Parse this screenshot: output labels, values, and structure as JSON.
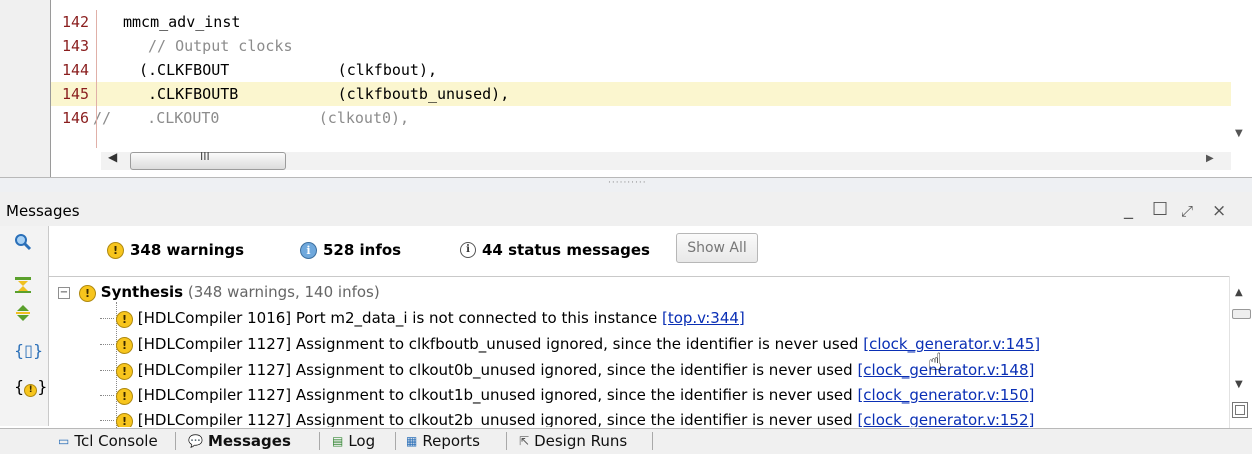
{
  "editor": {
    "lines": [
      {
        "num": "142",
        "text": "mmcm_adv_inst",
        "indent": 1
      },
      {
        "num": "143",
        "text": "// Output clocks",
        "indent": 3
      },
      {
        "num": "144",
        "text": "(.CLKFBOUT            (clkfbout),",
        "indent": 2
      },
      {
        "num": "145",
        "text": ".CLKFBOUTB           (clkfboutb_unused),",
        "indent": 3
      },
      {
        "num": "146",
        "text": "//    .CLKOUT0           (clkout0),",
        "indent": 0
      }
    ],
    "highlighted_line": "145",
    "hscroll_grip": "III"
  },
  "messages_panel": {
    "title": "Messages",
    "window_controls": {
      "minimize": "_",
      "maximize": "☐",
      "float": "⤢",
      "close": "×"
    },
    "filters": {
      "warnings": "348 warnings",
      "infos": "528 infos",
      "status": "44 status messages",
      "show_all": "Show All"
    },
    "toolbar_icons": [
      "search-icon",
      "collapse-all-icon",
      "expand-all-icon",
      "group-icon",
      "warning-filter-icon"
    ],
    "tree": {
      "group": {
        "label": "Synthesis",
        "summary": "(348 warnings, 140 infos)",
        "expander": "−"
      },
      "messages": [
        {
          "text": "[HDLCompiler 1016] Port m2_data_i is not connected to this instance ",
          "link": "[top.v:344]"
        },
        {
          "text": "[HDLCompiler 1127] Assignment to clkfboutb_unused ignored, since the identifier is never used ",
          "link": "[clock_generator.v:145]"
        },
        {
          "text": "[HDLCompiler 1127] Assignment to clkout0b_unused ignored, since the identifier is never used ",
          "link": "[clock_generator.v:148]"
        },
        {
          "text": "[HDLCompiler 1127] Assignment to clkout1b_unused ignored, since the identifier is never used ",
          "link": "[clock_generator.v:150]"
        },
        {
          "text": "[HDLCompiler 1127] Assignment to clkout2b_unused ignored, since the identifier is never used ",
          "link": "[clock_generator.v:152]"
        }
      ]
    }
  },
  "tabs": [
    {
      "label": "Tcl Console",
      "icon": "console-icon",
      "active": false
    },
    {
      "label": "Messages",
      "icon": "messages-icon",
      "active": true
    },
    {
      "label": "Log",
      "icon": "log-icon",
      "active": false
    },
    {
      "label": "Reports",
      "icon": "reports-icon",
      "active": false
    },
    {
      "label": "Design Runs",
      "icon": "design-runs-icon",
      "active": false
    }
  ],
  "colors": {
    "highlight_line": "#fbf6cf",
    "line_number": "#8a1e1e",
    "link": "#0a2fb5",
    "warning": "#f7c51d",
    "info": "#6fa8dc"
  }
}
